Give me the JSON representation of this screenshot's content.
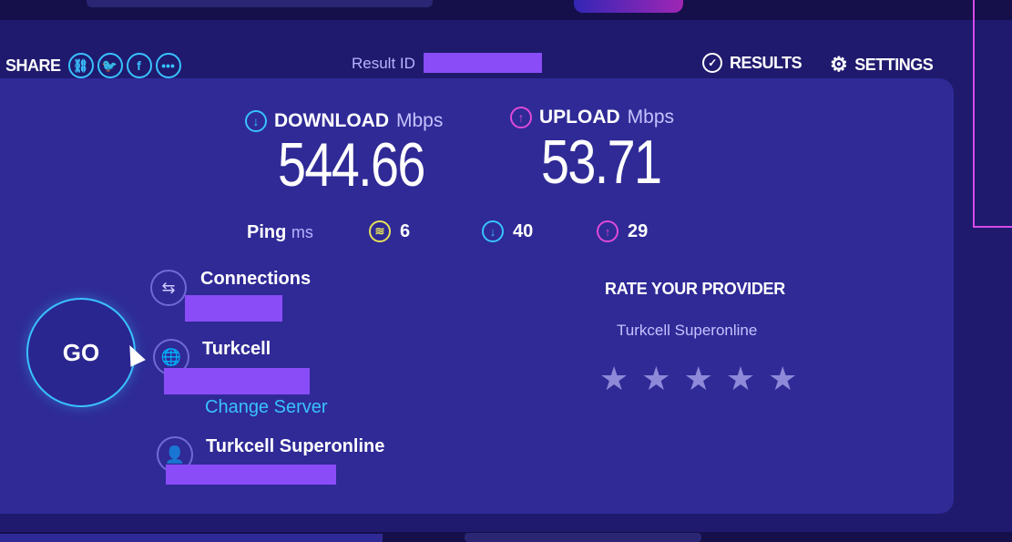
{
  "header": {
    "share_label": "SHARE",
    "share_icons": [
      "link-icon",
      "twitter-icon",
      "facebook-icon",
      "more-icon"
    ],
    "result_label": "Result ID",
    "results_label": "RESULTS",
    "settings_label": "SETTINGS"
  },
  "download": {
    "label": "DOWNLOAD",
    "unit": "Mbps",
    "value": "544.66"
  },
  "upload": {
    "label": "UPLOAD",
    "unit": "Mbps",
    "value": "53.71"
  },
  "ping": {
    "label": "Ping",
    "unit": "ms",
    "idle": "6",
    "download": "40",
    "upload": "29"
  },
  "go_label": "GO",
  "connections": {
    "label": "Connections"
  },
  "server": {
    "name": "Turkcell",
    "change_label": "Change Server"
  },
  "isp": {
    "name": "Turkcell Superonline"
  },
  "rating": {
    "title": "RATE YOUR PROVIDER",
    "provider": "Turkcell Superonline",
    "stars": 5
  },
  "colors": {
    "background": "#1f1a6e",
    "card": "#2f2a96",
    "accent_blue": "#39c2ff",
    "accent_pink": "#e04ad8",
    "ping_yellow": "#e6e25a",
    "redaction": "#8a4cf6"
  }
}
